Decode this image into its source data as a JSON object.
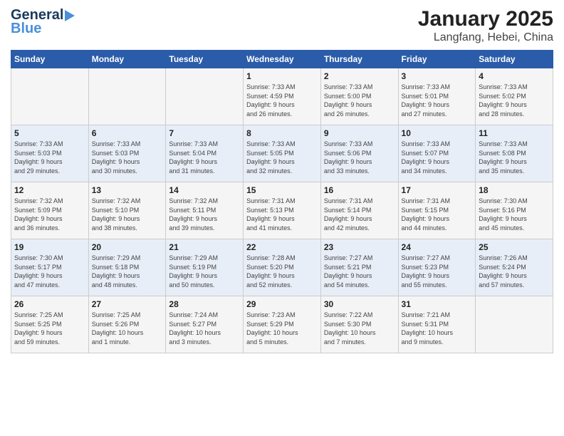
{
  "logo": {
    "line1": "General",
    "line2": "Blue"
  },
  "title": "January 2025",
  "subtitle": "Langfang, Hebei, China",
  "headers": [
    "Sunday",
    "Monday",
    "Tuesday",
    "Wednesday",
    "Thursday",
    "Friday",
    "Saturday"
  ],
  "weeks": [
    [
      {
        "day": "",
        "info": ""
      },
      {
        "day": "",
        "info": ""
      },
      {
        "day": "",
        "info": ""
      },
      {
        "day": "1",
        "info": "Sunrise: 7:33 AM\nSunset: 4:59 PM\nDaylight: 9 hours\nand 26 minutes."
      },
      {
        "day": "2",
        "info": "Sunrise: 7:33 AM\nSunset: 5:00 PM\nDaylight: 9 hours\nand 26 minutes."
      },
      {
        "day": "3",
        "info": "Sunrise: 7:33 AM\nSunset: 5:01 PM\nDaylight: 9 hours\nand 27 minutes."
      },
      {
        "day": "4",
        "info": "Sunrise: 7:33 AM\nSunset: 5:02 PM\nDaylight: 9 hours\nand 28 minutes."
      }
    ],
    [
      {
        "day": "5",
        "info": "Sunrise: 7:33 AM\nSunset: 5:03 PM\nDaylight: 9 hours\nand 29 minutes."
      },
      {
        "day": "6",
        "info": "Sunrise: 7:33 AM\nSunset: 5:03 PM\nDaylight: 9 hours\nand 30 minutes."
      },
      {
        "day": "7",
        "info": "Sunrise: 7:33 AM\nSunset: 5:04 PM\nDaylight: 9 hours\nand 31 minutes."
      },
      {
        "day": "8",
        "info": "Sunrise: 7:33 AM\nSunset: 5:05 PM\nDaylight: 9 hours\nand 32 minutes."
      },
      {
        "day": "9",
        "info": "Sunrise: 7:33 AM\nSunset: 5:06 PM\nDaylight: 9 hours\nand 33 minutes."
      },
      {
        "day": "10",
        "info": "Sunrise: 7:33 AM\nSunset: 5:07 PM\nDaylight: 9 hours\nand 34 minutes."
      },
      {
        "day": "11",
        "info": "Sunrise: 7:33 AM\nSunset: 5:08 PM\nDaylight: 9 hours\nand 35 minutes."
      }
    ],
    [
      {
        "day": "12",
        "info": "Sunrise: 7:32 AM\nSunset: 5:09 PM\nDaylight: 9 hours\nand 36 minutes."
      },
      {
        "day": "13",
        "info": "Sunrise: 7:32 AM\nSunset: 5:10 PM\nDaylight: 9 hours\nand 38 minutes."
      },
      {
        "day": "14",
        "info": "Sunrise: 7:32 AM\nSunset: 5:11 PM\nDaylight: 9 hours\nand 39 minutes."
      },
      {
        "day": "15",
        "info": "Sunrise: 7:31 AM\nSunset: 5:13 PM\nDaylight: 9 hours\nand 41 minutes."
      },
      {
        "day": "16",
        "info": "Sunrise: 7:31 AM\nSunset: 5:14 PM\nDaylight: 9 hours\nand 42 minutes."
      },
      {
        "day": "17",
        "info": "Sunrise: 7:31 AM\nSunset: 5:15 PM\nDaylight: 9 hours\nand 44 minutes."
      },
      {
        "day": "18",
        "info": "Sunrise: 7:30 AM\nSunset: 5:16 PM\nDaylight: 9 hours\nand 45 minutes."
      }
    ],
    [
      {
        "day": "19",
        "info": "Sunrise: 7:30 AM\nSunset: 5:17 PM\nDaylight: 9 hours\nand 47 minutes."
      },
      {
        "day": "20",
        "info": "Sunrise: 7:29 AM\nSunset: 5:18 PM\nDaylight: 9 hours\nand 48 minutes."
      },
      {
        "day": "21",
        "info": "Sunrise: 7:29 AM\nSunset: 5:19 PM\nDaylight: 9 hours\nand 50 minutes."
      },
      {
        "day": "22",
        "info": "Sunrise: 7:28 AM\nSunset: 5:20 PM\nDaylight: 9 hours\nand 52 minutes."
      },
      {
        "day": "23",
        "info": "Sunrise: 7:27 AM\nSunset: 5:21 PM\nDaylight: 9 hours\nand 54 minutes."
      },
      {
        "day": "24",
        "info": "Sunrise: 7:27 AM\nSunset: 5:23 PM\nDaylight: 9 hours\nand 55 minutes."
      },
      {
        "day": "25",
        "info": "Sunrise: 7:26 AM\nSunset: 5:24 PM\nDaylight: 9 hours\nand 57 minutes."
      }
    ],
    [
      {
        "day": "26",
        "info": "Sunrise: 7:25 AM\nSunset: 5:25 PM\nDaylight: 9 hours\nand 59 minutes."
      },
      {
        "day": "27",
        "info": "Sunrise: 7:25 AM\nSunset: 5:26 PM\nDaylight: 10 hours\nand 1 minute."
      },
      {
        "day": "28",
        "info": "Sunrise: 7:24 AM\nSunset: 5:27 PM\nDaylight: 10 hours\nand 3 minutes."
      },
      {
        "day": "29",
        "info": "Sunrise: 7:23 AM\nSunset: 5:29 PM\nDaylight: 10 hours\nand 5 minutes."
      },
      {
        "day": "30",
        "info": "Sunrise: 7:22 AM\nSunset: 5:30 PM\nDaylight: 10 hours\nand 7 minutes."
      },
      {
        "day": "31",
        "info": "Sunrise: 7:21 AM\nSunset: 5:31 PM\nDaylight: 10 hours\nand 9 minutes."
      },
      {
        "day": "",
        "info": ""
      }
    ]
  ]
}
